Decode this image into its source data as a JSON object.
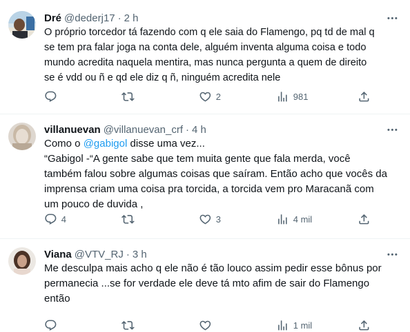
{
  "tweets": [
    {
      "name": "Dré",
      "handle": "@dederj17",
      "dot": "·",
      "time": "2 h",
      "lines": [
        "O próprio torcedor tá fazendo com q ele saia do Flamengo, pq td de mal q",
        "se tem pra falar joga na conta dele, alguém inventa alguma coisa e todo",
        "mundo acredita naquela mentira, mas nunca pergunta a quem de direito",
        "se é vdd ou ñ e qd ele diz q ñ, ninguém acredita nele"
      ],
      "replies": "",
      "retweets": "",
      "likes": "2",
      "views": "981"
    },
    {
      "name": "villanuevan",
      "handle": "@villanuevan_crf",
      "dot": "·",
      "time": "4 h",
      "line1_prefix": "Como o ",
      "line1_mention": "@gabigol",
      "line1_suffix": " disse uma vez...",
      "lines": [
        "“Gabigol -“A gente sabe que tem muita gente que fala merda, você",
        "também falou sobre algumas coisas que saíram. Então acho que vocês da",
        "imprensa criam uma coisa pra torcida, a torcida vem pro Maracanã com",
        "um pouco de  duvida ,"
      ],
      "replies": "4",
      "retweets": "",
      "likes": "3",
      "views": "4 mil"
    },
    {
      "name": "Viana",
      "handle": "@VTV_RJ",
      "dot": "·",
      "time": "3 h",
      "lines": [
        "Me desculpa mais acho q ele não é tão louco assim pedir esse bônus por",
        "permanecia ...se for verdade ele deve tá mto afim de sair do Flamengo",
        "então"
      ],
      "replies": "",
      "retweets": "",
      "likes": "",
      "views": "1 mil"
    }
  ],
  "icons": {
    "reply": "reply-icon",
    "retweet": "retweet-icon",
    "like": "like-icon",
    "views": "views-icon",
    "share": "share-icon",
    "more": "more-icon"
  },
  "colors": {
    "text": "#0f1419",
    "secondary": "#536471",
    "link": "#1d9bf0",
    "divider": "#eff3f4"
  }
}
